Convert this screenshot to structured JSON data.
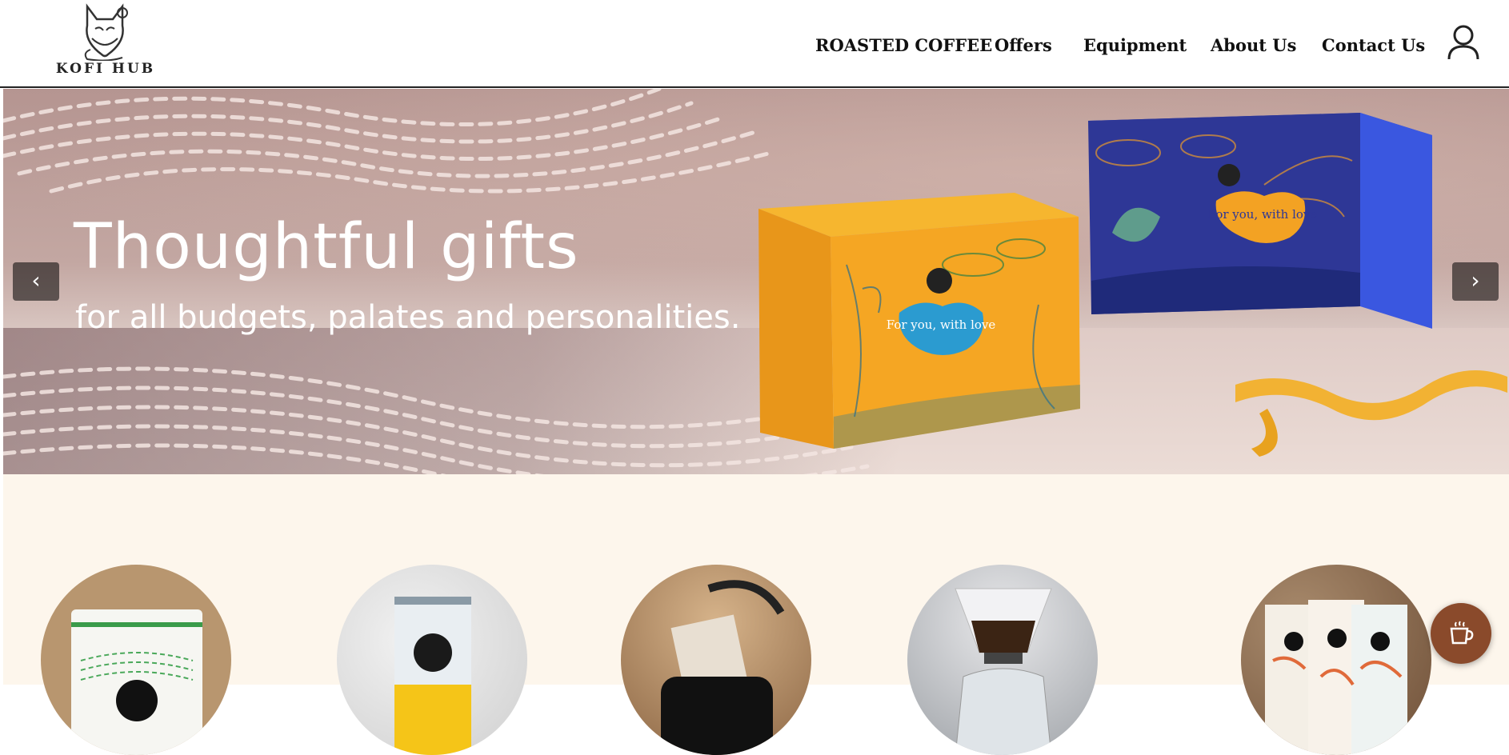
{
  "header": {
    "logo_text": "KOFI HUB",
    "nav": {
      "roasted_coffee": "ROASTED COFFEE",
      "offers": "Offers",
      "equipment": "Equipment",
      "about": "About Us",
      "contact": "Contact Us"
    },
    "icons": [
      "fox-logo-icon",
      "user-icon"
    ]
  },
  "hero": {
    "title": "Thoughtful gifts",
    "subtitle": "for all budgets, palates and personalities.",
    "prev_label": "‹",
    "next_label": "›",
    "box_text_1": "For you, with love",
    "box_text_2": "For you, with love"
  },
  "categories": {
    "items": [
      {
        "name": "coffee-pouch"
      },
      {
        "name": "coffee-can"
      },
      {
        "name": "drip-bag"
      },
      {
        "name": "pour-over-equipment"
      },
      {
        "name": "gift-pouches"
      }
    ]
  },
  "chat": {
    "icon": "coffee-cup-icon"
  },
  "colors": {
    "nav_text": "#111111",
    "section_bg": "#fdf6ec",
    "chat_button": "#8a4a2b",
    "yellow_box": "#f2a51f",
    "blue_box": "#3340a8"
  }
}
